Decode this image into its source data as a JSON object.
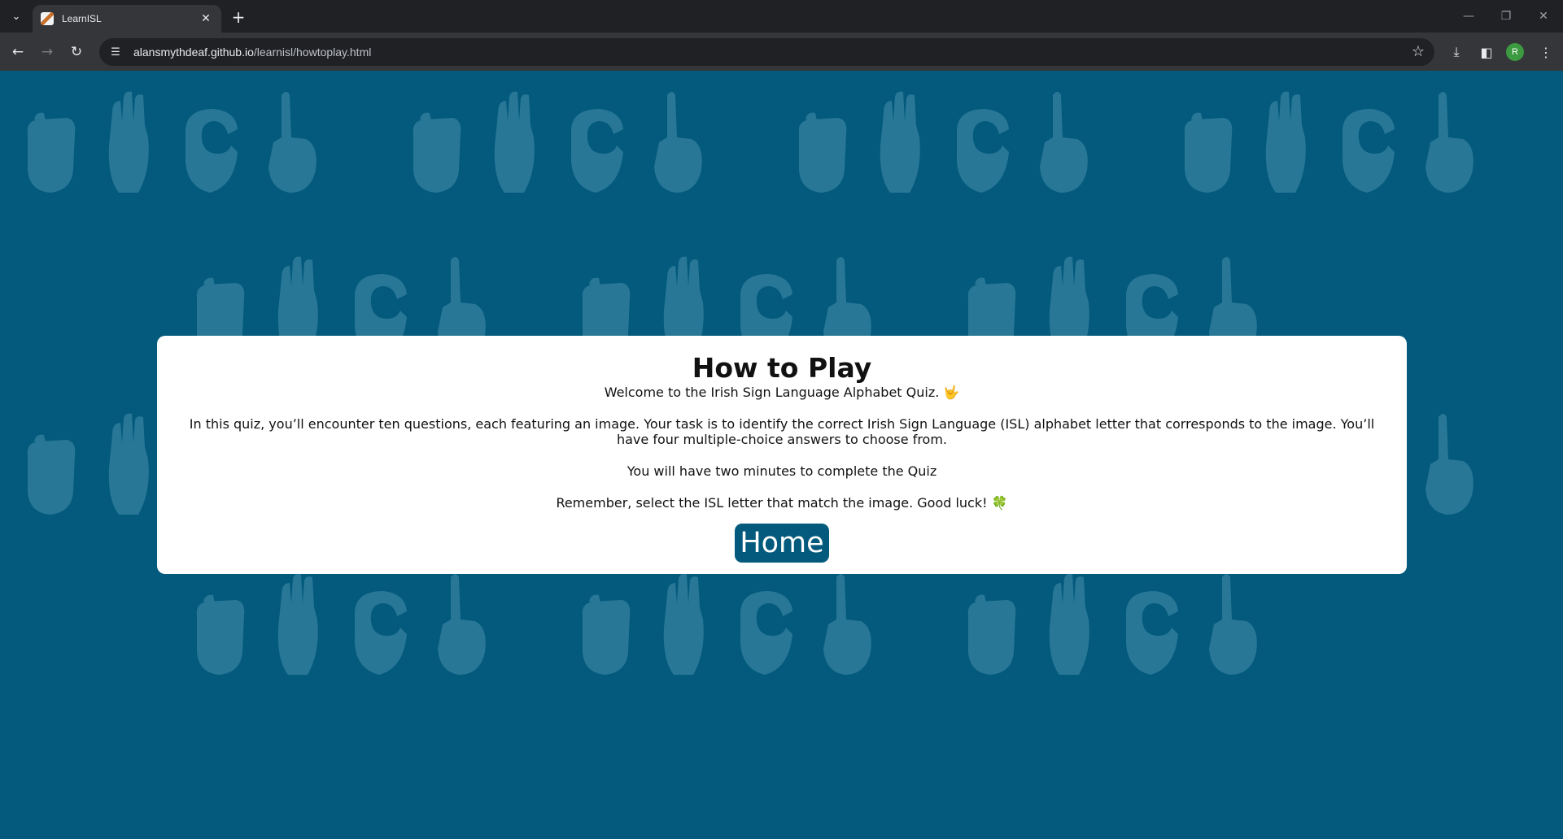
{
  "browser": {
    "tab_title": "LearnISL",
    "url_domain": "alansmythdeaf.github.io",
    "url_path": "/learnisl/howtoplay.html",
    "profile_initial": "R"
  },
  "icons": {
    "tab_search": "chevron-down-icon",
    "back": "arrow-left-icon",
    "forward": "arrow-right-icon",
    "reload": "reload-icon",
    "site_info": "tune-icon",
    "bookmark": "star-icon",
    "download": "download-icon",
    "side_panel": "side-panel-icon",
    "menu": "kebab-menu-icon"
  },
  "page": {
    "title": "How to Play",
    "intro": "Welcome to the Irish Sign Language Alphabet Quiz. 🤟",
    "paragraph_1": "In this quiz, you’ll encounter ten questions, each featuring an image. Your task is to identify the correct Irish Sign Language (ISL) alphabet letter that corresponds to the image. You’ll have four multiple-choice answers to choose from.",
    "paragraph_2": "You will have two minutes to complete the Quiz",
    "paragraph_3": "Remember, select the ISL letter that match the image. Good luck! 🍀",
    "home_button": "Home"
  },
  "colors": {
    "page_background": "#035a7c",
    "pattern": "#2f7c9c",
    "card": "#ffffff",
    "button": "#035a7c",
    "button_text": "#ffffff"
  }
}
